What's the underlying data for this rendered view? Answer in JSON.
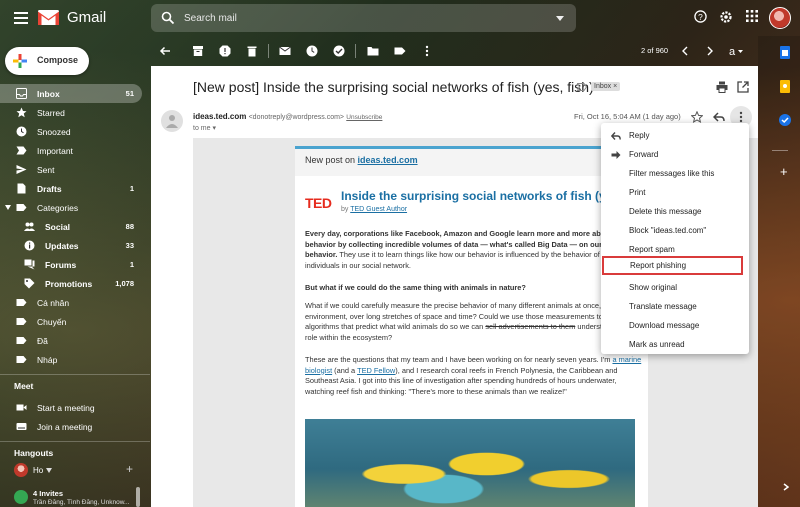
{
  "header": {
    "app_name": "Gmail",
    "search_placeholder": "Search mail"
  },
  "compose_label": "Compose",
  "nav": {
    "items": [
      {
        "label": "Inbox",
        "count": "51"
      },
      {
        "label": "Starred",
        "count": ""
      },
      {
        "label": "Snoozed",
        "count": ""
      },
      {
        "label": "Important",
        "count": ""
      },
      {
        "label": "Sent",
        "count": ""
      },
      {
        "label": "Drafts",
        "count": "1"
      },
      {
        "label": "Categories",
        "count": ""
      },
      {
        "label": "Social",
        "count": "88"
      },
      {
        "label": "Updates",
        "count": "33"
      },
      {
        "label": "Forums",
        "count": "1"
      },
      {
        "label": "Promotions",
        "count": "1,078"
      },
      {
        "label": "Cá nhân",
        "count": ""
      },
      {
        "label": "Chuyến",
        "count": ""
      },
      {
        "label": "Đã",
        "count": ""
      },
      {
        "label": "Nháp",
        "count": ""
      }
    ],
    "meet": {
      "heading": "Meet",
      "start": "Start a meeting",
      "join": "Join a meeting"
    },
    "hangouts": {
      "heading": "Hangouts",
      "user": "Ho",
      "invites_title": "4 Invites",
      "invites_names": "Trần Đăng, Tình Đăng, Unknow..."
    }
  },
  "toolbar": {
    "pager": "2 of 960"
  },
  "message": {
    "subject": "[New post] Inside the surprising social networks of fish (yes, fish)",
    "label_chip": "Inbox",
    "sender_name": "ideas.ted.com",
    "sender_address": "<donotreply@wordpress.com>",
    "unsubscribe": "Unsubscribe",
    "to": "to me",
    "date": "Fri, Oct 16, 5:04 AM (1 day ago)"
  },
  "post": {
    "newpost_prefix": "New post on",
    "newpost_link": "ideas.ted.com",
    "ted_logo": "TED",
    "title": "Inside the surprising social networks of fish (yes, fish)",
    "by_prefix": "by",
    "author": "TED Guest Author",
    "p1_bold": "Every day, corporations like Facebook, Amazon and Google learn more and more about human behavior by collecting incredible volumes of data — what's called Big Data — on our social behavior.",
    "p1_rest": " They use it to learn things like how our behavior is influenced by the behavior of other individuals in our social network.",
    "p2": "But what if we could do the same thing with animals in nature?",
    "p3_a": "What if we could carefully measure the precise behavior of many different animals at once, in a specific environment, over long stretches of space and time? Could we use those measurements to generate algorithms that predict what wild animals do so we can ",
    "p3_strike": "sell advertisements to them",
    "p3_b": " understand their role within the ecosystem?",
    "p4_a": "These are the questions that my team and I have been working on for nearly seven years. I'm ",
    "p4_link1": "a marine biologist",
    "p4_b": " (and a ",
    "p4_link2": "TED Fellow",
    "p4_c": "), and I research coral reefs in French Polynesia, the Caribbean and Southeast Asia. I got into this line of investigation after spending hundreds of hours underwater, watching reef fish and thinking: \"There's more to these animals than we realize!\""
  },
  "menu": {
    "items": [
      {
        "label": "Reply"
      },
      {
        "label": "Forward"
      },
      {
        "label": "Filter messages like this"
      },
      {
        "label": "Print"
      },
      {
        "label": "Delete this message"
      },
      {
        "label": "Block \"ideas.ted.com\""
      },
      {
        "label": "Report spam"
      },
      {
        "label": "Report phishing"
      },
      {
        "label": "Show original"
      },
      {
        "label": "Translate message"
      },
      {
        "label": "Download message"
      },
      {
        "label": "Mark as unread"
      }
    ],
    "highlighted": "Report phishing"
  },
  "colors": {
    "gmail_red": "#ea4335",
    "link_blue": "#1a6fa3",
    "ted_red": "#e62b1e",
    "highlight_border": "#d93b3b",
    "accent_bar": "#4aa3cf"
  },
  "icons": [
    "menu-icon",
    "search-icon",
    "help-icon",
    "settings-icon",
    "apps-icon",
    "back-icon",
    "archive-icon",
    "report-icon",
    "delete-icon",
    "mark-unread-icon",
    "snooze-icon",
    "add-task-icon",
    "move-icon",
    "label-icon",
    "more-icon",
    "print-icon",
    "open-new-window-icon",
    "star-icon",
    "reply-icon",
    "forward-icon"
  ]
}
